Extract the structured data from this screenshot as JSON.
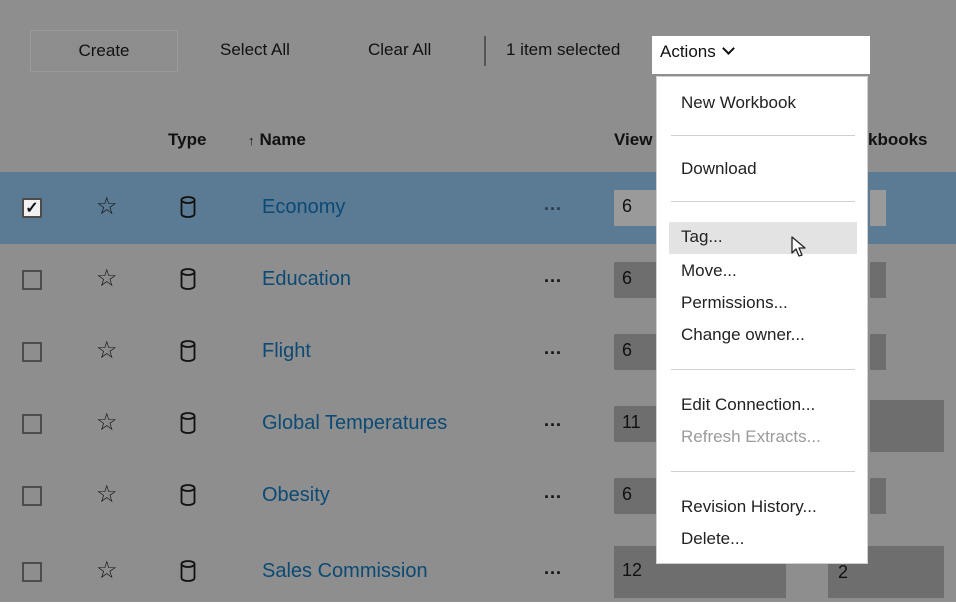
{
  "toolbar": {
    "create_label": "Create",
    "select_all_label": "Select All",
    "clear_all_label": "Clear All",
    "selection_status": "1 item selected",
    "actions_label": "Actions"
  },
  "columns": {
    "type": "Type",
    "name": "Name",
    "name_sort_indicator": "↑",
    "views": "View",
    "workbooks": "kbooks"
  },
  "rows": [
    {
      "name": "Economy",
      "views": "6",
      "checked": true,
      "more": "..."
    },
    {
      "name": "Education",
      "views": "6",
      "checked": false,
      "more": "..."
    },
    {
      "name": "Flight",
      "views": "6",
      "checked": false,
      "more": "..."
    },
    {
      "name": "Global Temperatures",
      "views": "11",
      "checked": false,
      "more": "..."
    },
    {
      "name": "Obesity",
      "views": "6",
      "checked": false,
      "more": "..."
    },
    {
      "name": "Sales Commission",
      "views": "12",
      "checked": false,
      "more": "...",
      "workbooks": "2"
    }
  ],
  "check_mark": "✓",
  "star_glyph": "☆",
  "menu": {
    "items": [
      {
        "label": "New Workbook",
        "disabled": false
      },
      {
        "label": "Download",
        "disabled": false
      },
      {
        "label": "Tag...",
        "disabled": false,
        "hovered": true
      },
      {
        "label": "Move...",
        "disabled": false
      },
      {
        "label": "Permissions...",
        "disabled": false
      },
      {
        "label": "Change owner...",
        "disabled": false
      },
      {
        "label": "Edit Connection...",
        "disabled": false
      },
      {
        "label": "Refresh Extracts...",
        "disabled": true
      },
      {
        "label": "Revision History...",
        "disabled": false
      },
      {
        "label": "Delete...",
        "disabled": false
      }
    ]
  },
  "icons": {
    "row_favorite": "star-icon",
    "row_type": "data-source-icon",
    "actions_caret": "chevron-down-icon",
    "pointer": "mouse-cursor-icon"
  },
  "colors": {
    "selected_row": "#5b7a93",
    "link": "#0b4a74",
    "overlay": "#8e8e8e"
  }
}
